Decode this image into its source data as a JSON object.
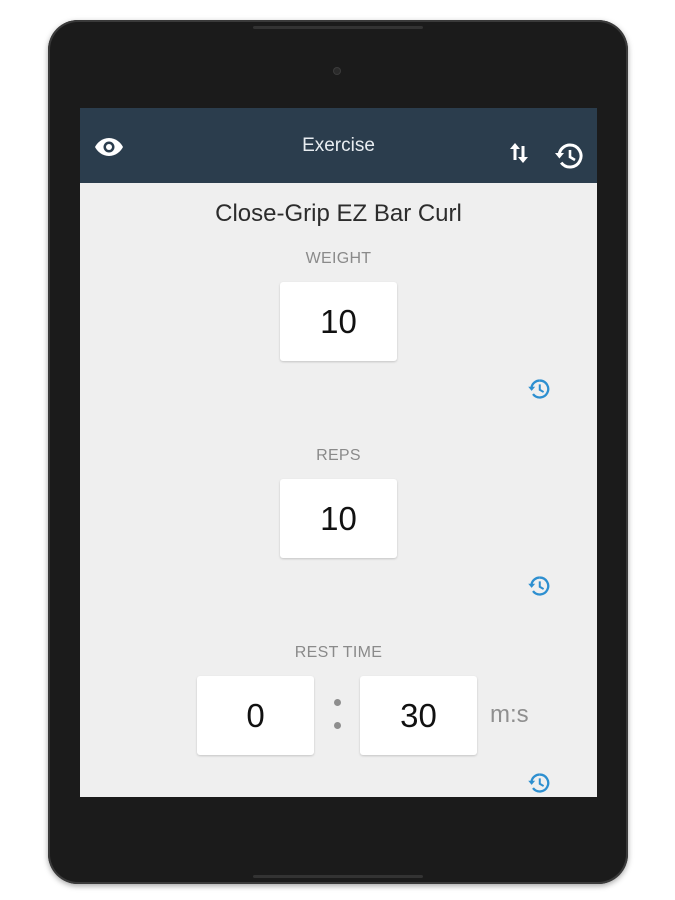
{
  "appbar": {
    "title": "Exercise",
    "left_icon": "eye-icon",
    "right_icons": [
      "swap-vertical-icon",
      "history-icon"
    ],
    "background_color": "#2b3d4d"
  },
  "exercise": {
    "name": "Close-Grip EZ Bar Curl"
  },
  "fields": {
    "weight": {
      "label": "WEIGHT",
      "value": "10"
    },
    "reps": {
      "label": "REPS",
      "value": "10"
    },
    "rest_time": {
      "label": "REST TIME",
      "minutes": "0",
      "seconds": "30",
      "unit": "m:s"
    }
  },
  "colors": {
    "accent": "#2d8fd0",
    "screen_background": "#efefef"
  }
}
